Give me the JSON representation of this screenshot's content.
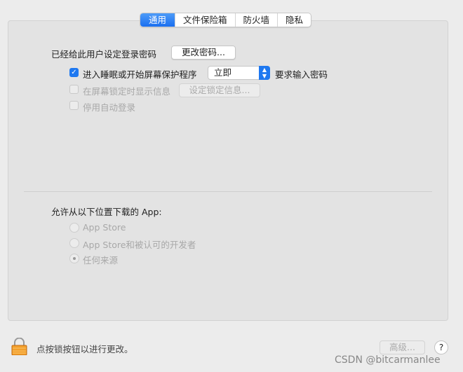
{
  "tabs": [
    {
      "label": "通用",
      "active": true
    },
    {
      "label": "文件保险箱"
    },
    {
      "label": "防火墙"
    },
    {
      "label": "隐私"
    }
  ],
  "general": {
    "password_set_label": "已经给此用户设定登录密码",
    "change_password_button": "更改密码...",
    "require_password": {
      "label": "进入睡眠或开始屏幕保护程序",
      "checked": true,
      "select_value": "立即",
      "suffix": "要求输入密码"
    },
    "show_message": {
      "label": "在屏幕锁定时显示信息",
      "checked": false,
      "disabled": true,
      "button": "设定锁定信息..."
    },
    "disable_autologin": {
      "label": "停用自动登录",
      "checked": false,
      "disabled": true
    }
  },
  "downloads": {
    "title": "允许从以下位置下载的 App:",
    "options": [
      {
        "label": "App Store",
        "selected": false
      },
      {
        "label": "App Store和被认可的开发者",
        "selected": false
      },
      {
        "label": "任何来源",
        "selected": true
      }
    ]
  },
  "footer": {
    "lock_text": "点按锁按钮以进行更改。",
    "advanced_button": "高级...",
    "help_button": "?"
  },
  "watermark": "CSDN @bitcarmanlee",
  "colors": {
    "accent": "#1e78f0"
  }
}
